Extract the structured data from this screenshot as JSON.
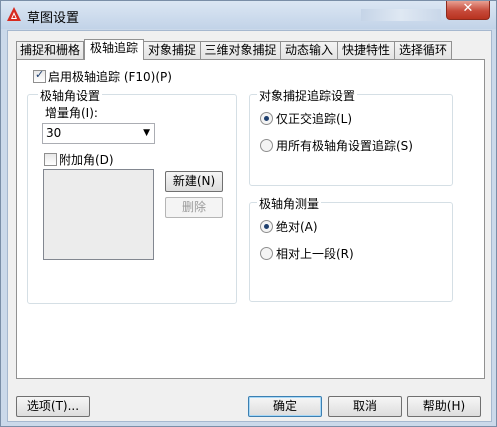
{
  "window": {
    "title": "草图设置",
    "close_label": "✕"
  },
  "tabs": [
    {
      "label": "捕捉和栅格"
    },
    {
      "label": "极轴追踪",
      "active": true
    },
    {
      "label": "对象捕捉"
    },
    {
      "label": "三维对象捕捉"
    },
    {
      "label": "动态输入"
    },
    {
      "label": "快捷特性"
    },
    {
      "label": "选择循环"
    }
  ],
  "polar": {
    "enable_label": "启用极轴追踪 (F10)(P)",
    "enabled": true,
    "angle_group_title": "极轴角设置",
    "increment_label": "增量角(I):",
    "increment_value": "30",
    "additional_label": "附加角(D)",
    "additional_checked": false,
    "new_button": "新建(N)",
    "delete_button": "删除"
  },
  "osnap_tracking": {
    "title": "对象捕捉追踪设置",
    "option_orthogonal": "仅正交追踪(L)",
    "option_all": "用所有极轴角设置追踪(S)",
    "selected": "orthogonal"
  },
  "measurement": {
    "title": "极轴角测量",
    "option_absolute": "绝对(A)",
    "option_relative": "相对上一段(R)",
    "selected": "absolute"
  },
  "footer": {
    "options_button": "选项(T)...",
    "ok_button": "确定",
    "cancel_button": "取消",
    "help_button": "帮助(H)"
  },
  "colors": {
    "accent": "#1e3f6e",
    "title_bar": "#c2d3e8",
    "close": "#c64a3a"
  }
}
